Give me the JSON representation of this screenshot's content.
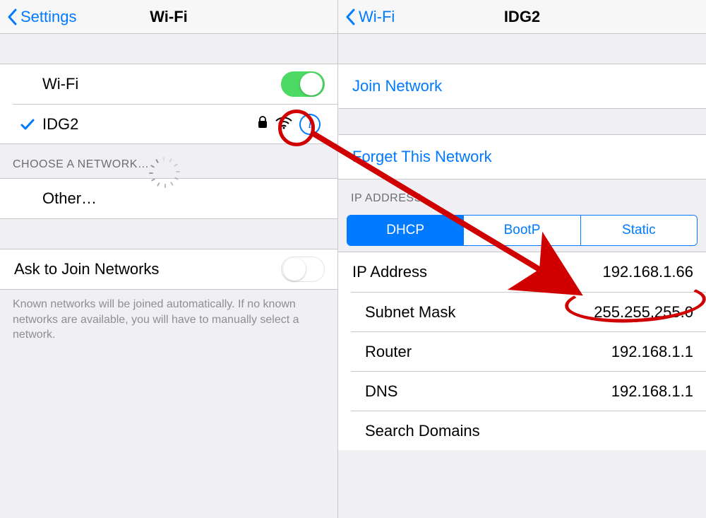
{
  "left": {
    "back_label": "Settings",
    "title": "Wi-Fi",
    "wifi_label": "Wi-Fi",
    "wifi_on": true,
    "connected_network": "IDG2",
    "choose_header": "CHOOSE A NETWORK…",
    "other_label": "Other…",
    "ask_label": "Ask to Join Networks",
    "ask_on": false,
    "footer": "Known networks will be joined automatically. If no known networks are available, you will have to manually select a network."
  },
  "right": {
    "back_label": "Wi-Fi",
    "title": "IDG2",
    "join_label": "Join Network",
    "forget_label": "Forget This Network",
    "ip_header": "IP ADDRESS",
    "tabs": {
      "dhcp": "DHCP",
      "bootp": "BootP",
      "static": "Static"
    },
    "selected_tab": "DHCP",
    "rows": {
      "ip": {
        "label": "IP Address",
        "value": "192.168.1.66"
      },
      "mask": {
        "label": "Subnet Mask",
        "value": "255.255.255.0"
      },
      "router": {
        "label": "Router",
        "value": "192.168.1.1"
      },
      "dns": {
        "label": "DNS",
        "value": "192.168.1.1"
      },
      "search": {
        "label": "Search Domains",
        "value": ""
      }
    }
  }
}
